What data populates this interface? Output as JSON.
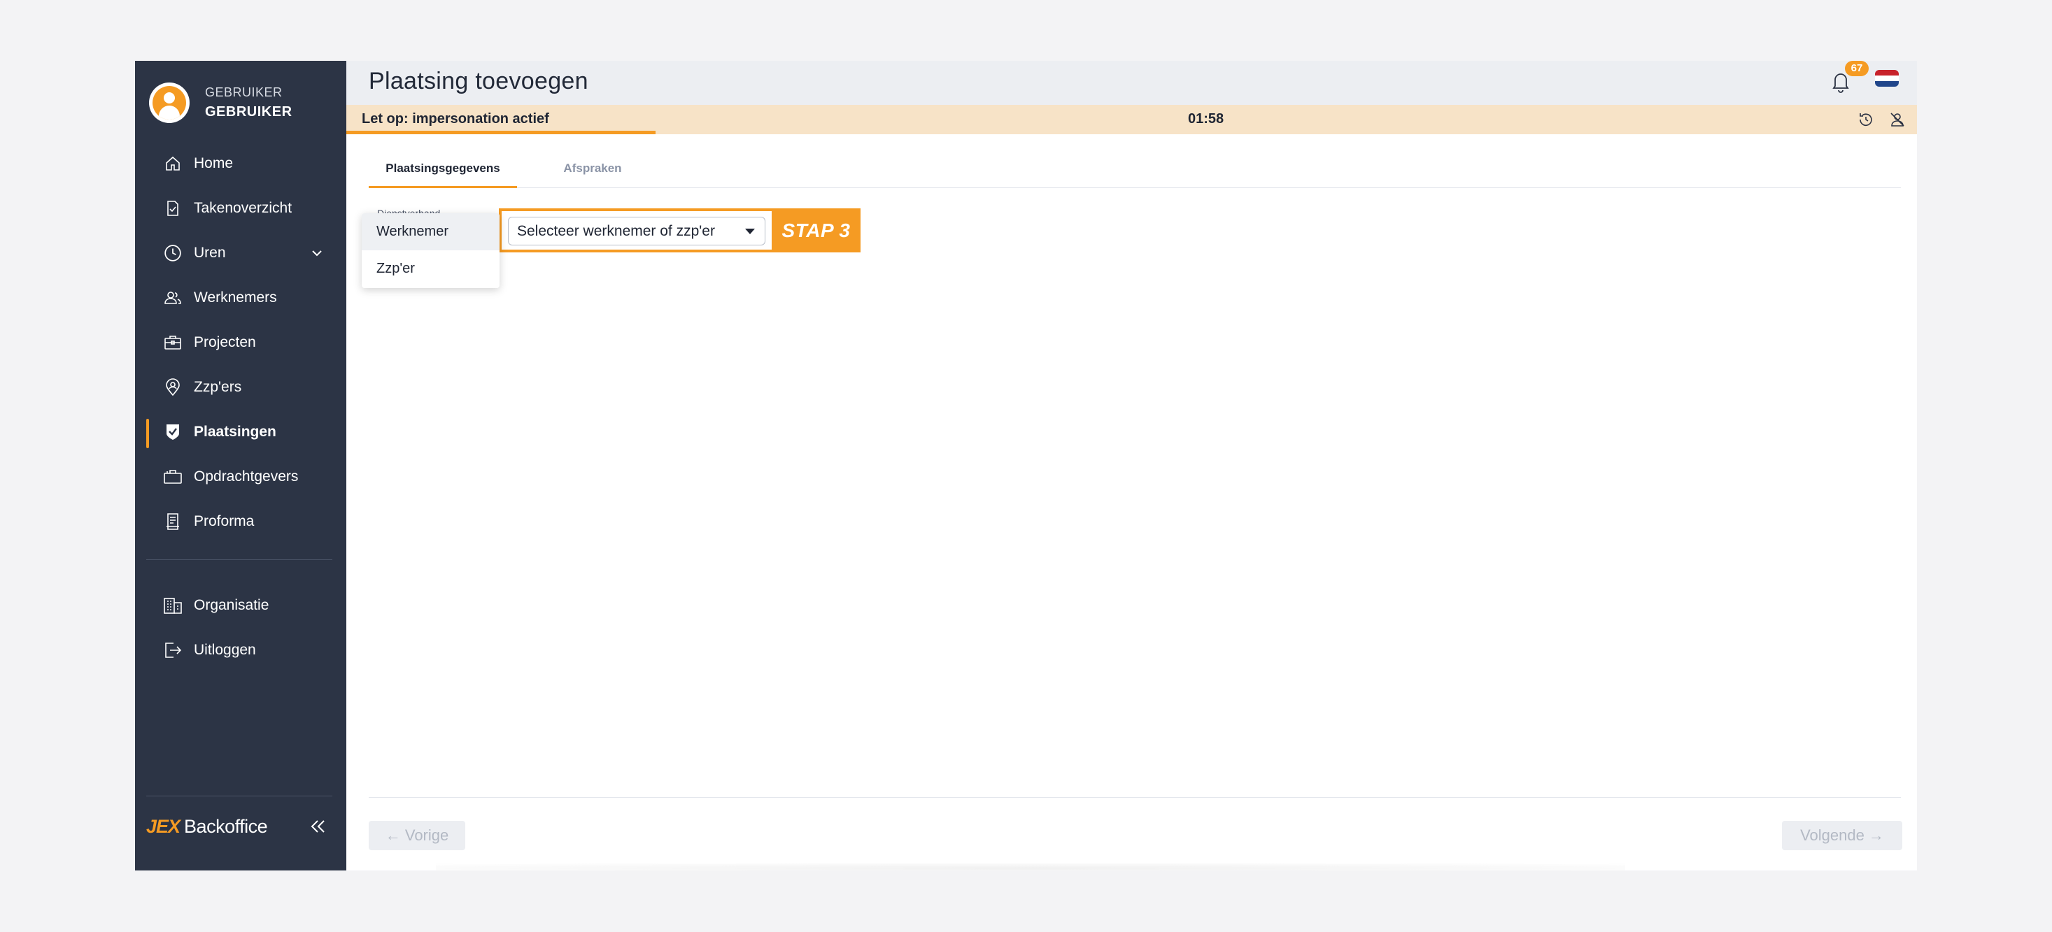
{
  "user": {
    "role": "GEBRUIKER",
    "name": "GEBRUIKER"
  },
  "nav": {
    "home": "Home",
    "takenoverzicht": "Takenoverzicht",
    "uren": "Uren",
    "werknemers": "Werknemers",
    "projecten": "Projecten",
    "zzpers": "Zzp'ers",
    "plaatsingen": "Plaatsingen",
    "opdrachtgevers": "Opdrachtgevers",
    "proforma": "Proforma",
    "organisatie": "Organisatie",
    "uitloggen": "Uitloggen"
  },
  "brand": {
    "logo": "JEX",
    "text": "Backoffice"
  },
  "header": {
    "title": "Plaatsing toevoegen",
    "notification_count": "67"
  },
  "impersonation": {
    "text": "Let op: impersonation actief",
    "timer": "01:58",
    "progress": 0.197
  },
  "tabs": {
    "active": "Plaatsingsgegevens",
    "inactive": "Afspraken"
  },
  "form": {
    "field_label": "Dienstverband",
    "select_value": "Selecteer werknemer of zzp'er",
    "step_label": "STAP 3",
    "options": [
      "Werknemer",
      "Zzp'er"
    ]
  },
  "footer": {
    "prev": "← Vorige",
    "next": "Volgende →"
  },
  "colors": {
    "sidebar": "#2c3445",
    "accent": "#f59b23",
    "impersonation_bg": "#f7e3c7"
  },
  "icons": [
    "home-icon",
    "task-icon",
    "clock-icon",
    "users-icon",
    "briefcase-icon",
    "location-icon",
    "shield-check-icon",
    "clients-icon",
    "invoice-icon",
    "building-icon",
    "logout-icon",
    "bell-icon",
    "flag-nl-icon",
    "history-icon",
    "user-off-icon",
    "collapse-icon"
  ]
}
